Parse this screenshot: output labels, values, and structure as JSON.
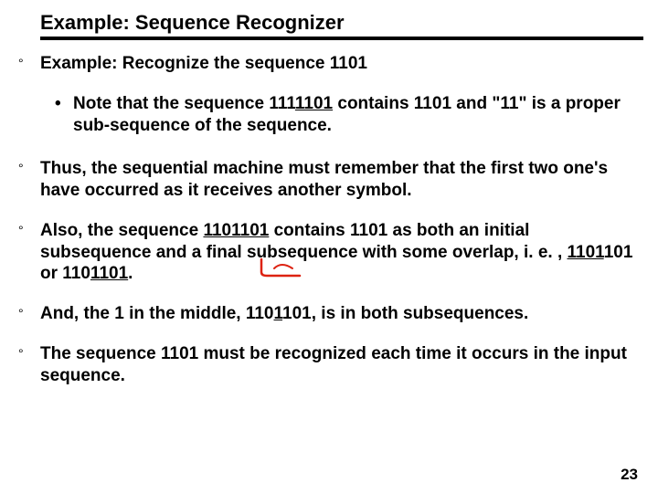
{
  "title": "Example: Sequence Recognizer",
  "bullets": {
    "b1": "Example:  Recognize the sequence 1101",
    "sub1_pre": "Note that the sequence 111",
    "sub1_u": "1101",
    "sub1_post": " contains 1101 and \"11\" is a proper sub-sequence of the sequence.",
    "b2": "Thus, the sequential machine must remember that the first two one's have occurred as it receives another symbol.",
    "b3_pre": "Also, the sequence ",
    "b3_u1": "1101101",
    "b3_mid": " contains 1101 as both an initial subsequence and a final subsequence with some overlap, i. e. , ",
    "b3_u2": "1101",
    "b3_mid2": "101 or 110",
    "b3_u3": "1101",
    "b3_end": ".",
    "b4_pre": "And, the 1 in the middle, 110",
    "b4_u": "1",
    "b4_post": "101, is in both subsequences.",
    "b5": "The sequence 1101 must be recognized each time it occurs in the input sequence."
  },
  "page_number": "23",
  "marks": {
    "deg": "°",
    "dot": "•"
  }
}
